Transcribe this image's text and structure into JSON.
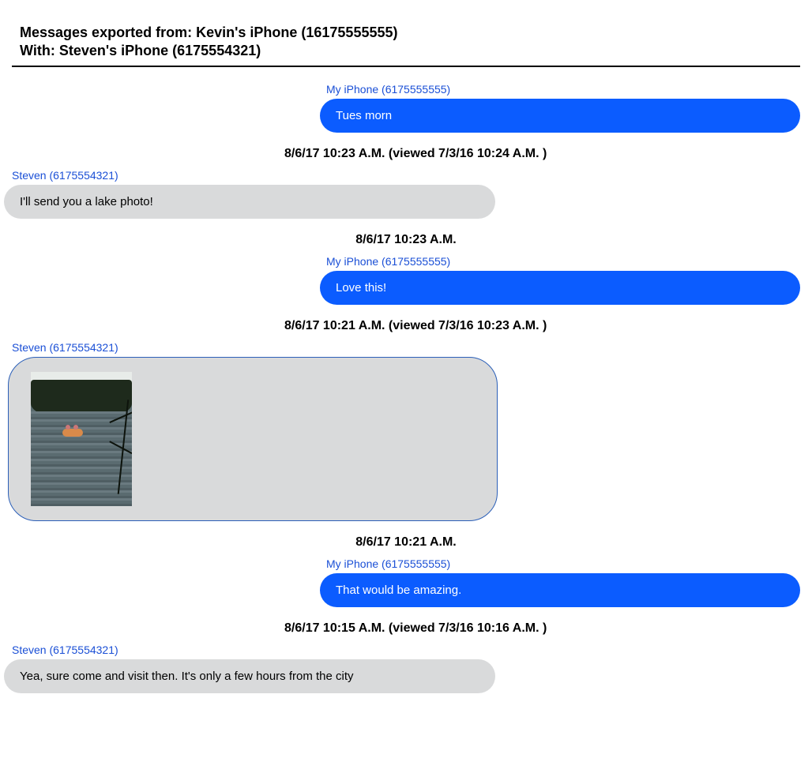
{
  "header": {
    "line1": "Messages exported from: Kevin's iPhone (16175555555)",
    "line2": "With: Steven's iPhone (6175554321)"
  },
  "senders": {
    "me": "My iPhone (6175555555)",
    "other": "Steven (6175554321)"
  },
  "messages": [
    {
      "dir": "out",
      "text": "Tues morn"
    },
    {
      "ts": "8/6/17 10:23 A.M. (viewed 7/3/16 10:24 A.M. )"
    },
    {
      "dir": "in",
      "text": "I'll send you a lake photo!"
    },
    {
      "ts_center": "8/6/17 10:23 A.M."
    },
    {
      "dir": "out",
      "text": "Love this!"
    },
    {
      "ts": "8/6/17 10:21 A.M. (viewed 7/3/16 10:23 A.M. )"
    },
    {
      "dir": "in_image",
      "alt": "lake-photo"
    },
    {
      "ts_center": "8/6/17 10:21 A.M."
    },
    {
      "dir": "out",
      "text": "That would be amazing."
    },
    {
      "ts": "8/6/17 10:15 A.M. (viewed 7/3/16 10:16 A.M. )"
    },
    {
      "dir": "in",
      "text": "Yea, sure come and visit then. It's only a few hours from the city"
    }
  ]
}
